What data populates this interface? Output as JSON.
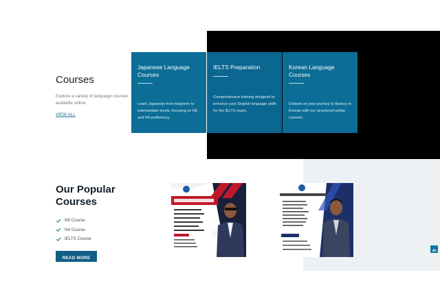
{
  "courses_section": {
    "heading": "Courses",
    "description": "Explore a variety of language courses available online.",
    "view_all": "VIEW ALL"
  },
  "cards": [
    {
      "title": "Japanese Language Courses",
      "text": "Learn Japanese from beginner to intermediate levels, focusing on N5 and N4 proficiency."
    },
    {
      "title": "IELTS Preparation",
      "text": "Comprehensive training designed to enhance your English language skills for the IELTS exam."
    },
    {
      "title": "Korean Language Courses",
      "text": "Embark on your journey to fluency in Korean with our structured online courses."
    }
  ],
  "popular": {
    "heading_line1": "Our Popular",
    "heading_line2": "Courses",
    "items": [
      "N5 Course",
      "N4 Course",
      "IELTS Course"
    ],
    "read_more": "READ MORE"
  },
  "colors": {
    "card_blue": "#0c6d97",
    "button_blue": "#0f5f86",
    "check_green": "#1e8a9e",
    "accent_red": "#c0182b"
  },
  "icons": {
    "check": "check-icon",
    "scroll_top": "chevron-up-icon"
  }
}
